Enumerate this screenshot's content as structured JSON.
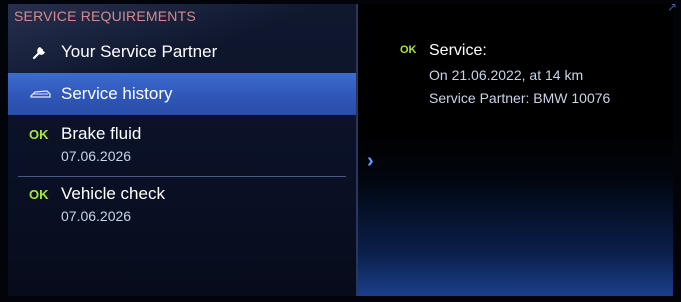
{
  "header": {
    "title": "SERVICE REQUIREMENTS"
  },
  "menu": {
    "partner": {
      "label": "Your Service Partner",
      "icon": "wrench-icon"
    },
    "history": {
      "label": "Service history",
      "icon": "car-icon"
    },
    "brake": {
      "status": "OK",
      "label": "Brake fluid",
      "date": "07.06.2026"
    },
    "vehicle": {
      "status": "OK",
      "label": "Vehicle check",
      "date": "07.06.2026"
    }
  },
  "detail": {
    "status": "OK",
    "title": "Service:",
    "line1": "On 21.06.2022, at 14 km",
    "line2": "Service Partner: BMW 10076"
  },
  "colors": {
    "ok": "#a8e63d",
    "highlight": "#2f57b8",
    "title": "#d58b8b"
  }
}
